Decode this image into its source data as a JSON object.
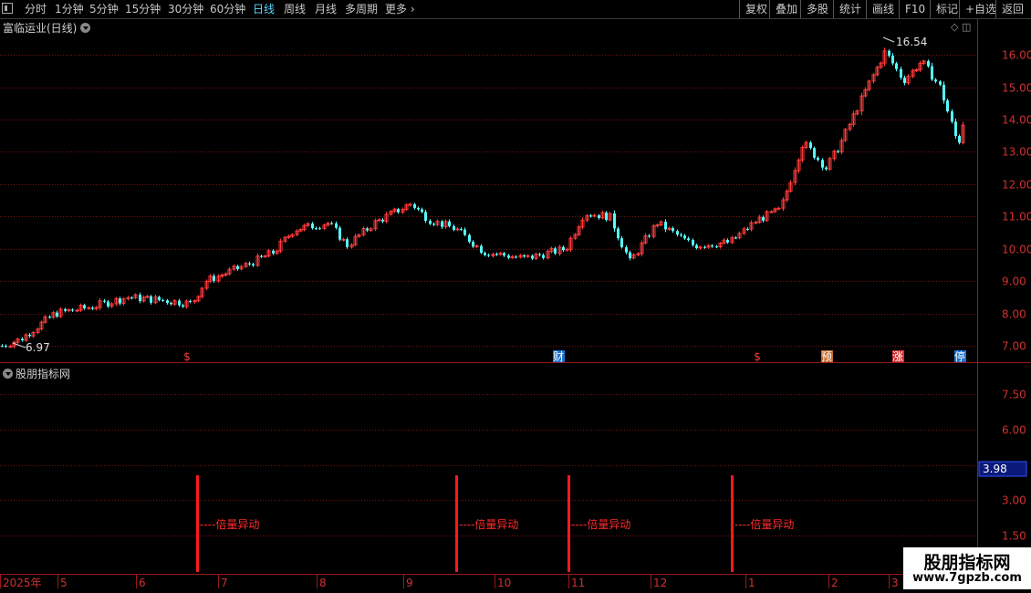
{
  "toolbar": {
    "tabs": [
      "分时",
      "1分钟",
      "5分钟",
      "15分钟",
      "30分钟",
      "60分钟",
      "日线",
      "周线",
      "月线",
      "多周期",
      "更多"
    ],
    "selected": "日线",
    "right_buttons": [
      "复权",
      "叠加",
      "多股",
      "统计",
      "画线",
      "F10",
      "标记",
      "+自选",
      "返回"
    ]
  },
  "main_panel": {
    "title": "富临运业(日线)",
    "y_ticks": [
      "16.00",
      "15.00",
      "14.00",
      "13.00",
      "12.00",
      "11.00",
      "10.00",
      "9.00",
      "8.00",
      "7.00"
    ],
    "high_label": "16.54",
    "low_label": "6.97",
    "markers": [
      {
        "text": "$",
        "color": "#ff3b3b",
        "bg": ""
      },
      {
        "text": "财",
        "color": "#ffffff",
        "bg": "#1a6fd0"
      },
      {
        "text": "$",
        "color": "#ff3b3b",
        "bg": ""
      },
      {
        "text": "预",
        "color": "#ffffff",
        "bg": "#c46a2a"
      },
      {
        "text": "涨",
        "color": "#ffffff",
        "bg": "#d23030"
      },
      {
        "text": "停",
        "color": "#ffffff",
        "bg": "#1a6fd0"
      }
    ]
  },
  "indicator_panel": {
    "title": "股朋指标网",
    "y_ticks": [
      "7.50",
      "6.00",
      "3.00",
      "1.50"
    ],
    "current_value": "3.98",
    "signal_label": "----倍量异动",
    "signal_count": 4
  },
  "x_axis": {
    "labels": [
      "2025年",
      "5",
      "6",
      "7",
      "8",
      "9",
      "10",
      "11",
      "12",
      "1",
      "2",
      "3"
    ]
  },
  "watermark": {
    "line1": "股朋指标网",
    "line2": "www.7gpzb.com"
  },
  "colors": {
    "up": "#ff3b3b",
    "down": "#54ffff",
    "grid": "#7a1010",
    "axis_text": "#d03030",
    "selected_tab": "#5ad7ff"
  },
  "chart_data": {
    "type": "candlestick",
    "title": "富临运业(日线)",
    "y_range": [
      6.8,
      16.9
    ],
    "period_high": 16.54,
    "period_low": 6.97,
    "monthly_closes": [
      {
        "month": "2025-04",
        "close": 7.3
      },
      {
        "month": "2025-05",
        "close": 8.3
      },
      {
        "month": "2025-06",
        "close": 8.6
      },
      {
        "month": "2025-07",
        "close": 10.4
      },
      {
        "month": "2025-08",
        "close": 11.2
      },
      {
        "month": "2025-09",
        "close": 10.5
      },
      {
        "month": "2025-10",
        "close": 9.9
      },
      {
        "month": "2025-11",
        "close": 11.2
      },
      {
        "month": "2025-12",
        "close": 10.2
      },
      {
        "month": "2026-01",
        "close": 11.5
      },
      {
        "month": "2026-02",
        "close": 14.3
      },
      {
        "month": "2026-03",
        "close": 13.5
      }
    ],
    "indicator": {
      "name": "股朋指标网",
      "y_ticks": [
        7.5,
        6.0,
        3.0,
        1.5
      ],
      "current_value": 3.98,
      "signal_months": [
        "2025-06",
        "2025-09",
        "2025-10",
        "2025-12"
      ]
    }
  }
}
